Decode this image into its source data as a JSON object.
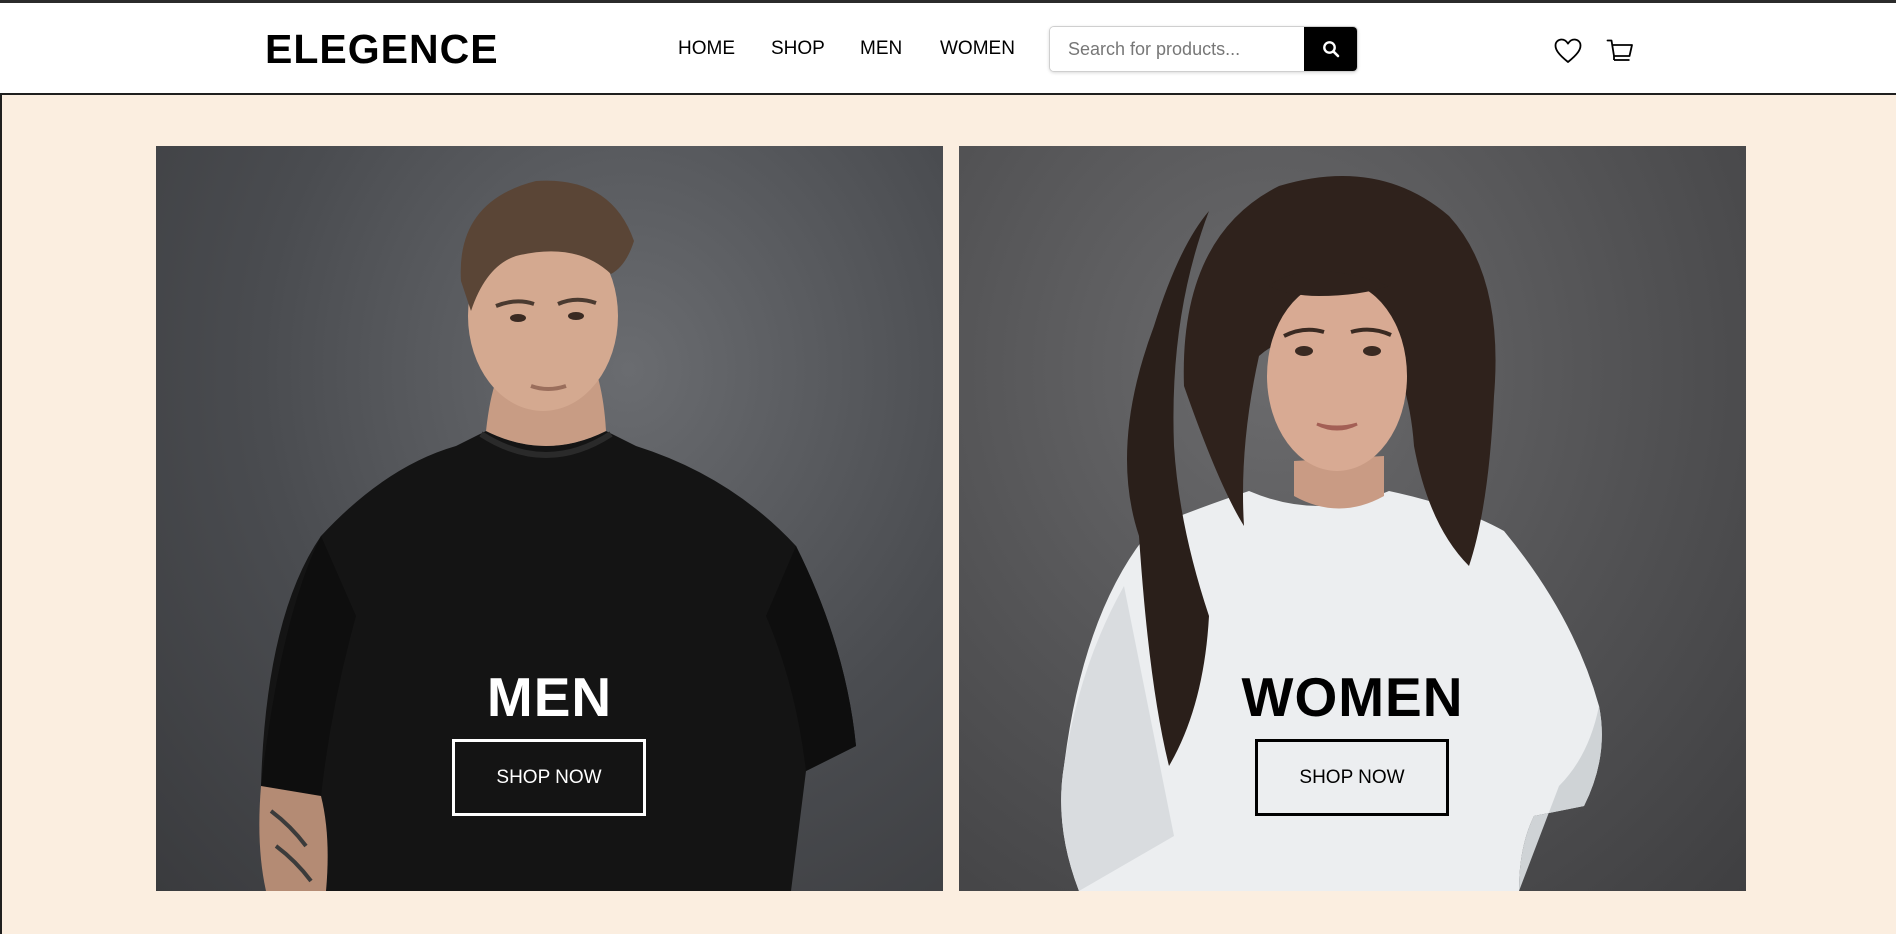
{
  "brand": {
    "logo_text": "ELEGENCE"
  },
  "nav": {
    "items": [
      {
        "label": "HOME"
      },
      {
        "label": "SHOP"
      },
      {
        "label": "MEN"
      },
      {
        "label": "WOMEN"
      }
    ]
  },
  "search": {
    "placeholder": "Search for products...",
    "value": "",
    "button_icon": "search-icon"
  },
  "header_icons": {
    "wishlist": "heart-icon",
    "cart": "cart-icon"
  },
  "colors": {
    "hero_background": "#fbeee0",
    "header_background": "#ffffff",
    "search_button": "#000000"
  },
  "hero": {
    "cards": [
      {
        "title": "MEN",
        "button_label": "SHOP NOW",
        "image": "man-in-black-tshirt"
      },
      {
        "title": "WOMEN",
        "button_label": "SHOP NOW",
        "image": "woman-in-white-tshirt"
      }
    ]
  }
}
